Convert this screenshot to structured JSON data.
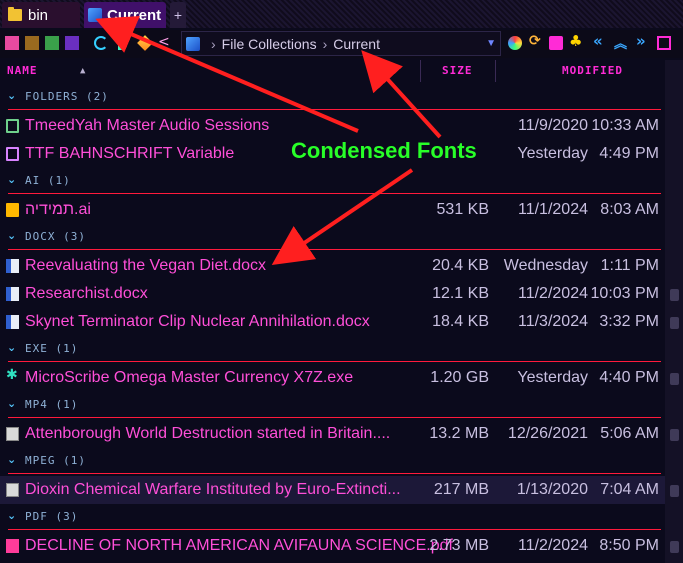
{
  "tabs": [
    {
      "label": "bin"
    },
    {
      "label": "Current"
    },
    {
      "label": "+"
    }
  ],
  "breadcrumb": {
    "root": "File Collections",
    "separator": "›",
    "current": "Current"
  },
  "columns": {
    "name": "NAME",
    "size": "SIZE",
    "modified": "MODIFIED"
  },
  "groups": [
    {
      "label": "FOLDERS (2)",
      "files": [
        {
          "name": "TmeedYah Master Audio Sessions",
          "size": "",
          "date": "11/9/2020",
          "time": "10:33 AM",
          "icon": "folder-icon"
        },
        {
          "name": "TTF BAHNSCHRIFT Variable",
          "size": "",
          "date": "Yesterday",
          "time": "4:49 PM",
          "icon": "folder-icon"
        }
      ]
    },
    {
      "label": "AI (1)",
      "files": [
        {
          "name": "תמידיה.ai",
          "size": "531 KB",
          "date": "11/1/2024",
          "time": "8:03 AM",
          "icon": "ai-file-icon"
        }
      ]
    },
    {
      "label": "DOCX (3)",
      "files": [
        {
          "name": "Reevaluating the Vegan Diet.docx",
          "size": "20.4 KB",
          "date": "Wednesday",
          "time": "1:11 PM",
          "icon": "word-doc-icon"
        },
        {
          "name": "Researchist.docx",
          "size": "12.1 KB",
          "date": "11/2/2024",
          "time": "10:03 PM",
          "icon": "word-doc-icon"
        },
        {
          "name": "Skynet Terminator Clip Nuclear Annihilation.docx",
          "size": "18.4 KB",
          "date": "11/3/2024",
          "time": "3:32 PM",
          "icon": "word-doc-icon"
        }
      ]
    },
    {
      "label": "EXE (1)",
      "files": [
        {
          "name": "MicroScribe Omega Master Currency X7Z.exe",
          "size": "1.20 GB",
          "date": "Yesterday",
          "time": "4:40 PM",
          "icon": "exe-icon"
        }
      ]
    },
    {
      "label": "MP4 (1)",
      "files": [
        {
          "name": "Attenborough World Destruction started in Britain....",
          "size": "13.2 MB",
          "date": "12/26/2021",
          "time": "5:06 AM",
          "icon": "video-file-icon"
        }
      ]
    },
    {
      "label": "MPEG (1)",
      "files": [
        {
          "name": "Dioxin Chemical Warfare Instituted by Euro-Extincti...",
          "size": "217 MB",
          "date": "1/13/2020",
          "time": "7:04 AM",
          "icon": "video-file-icon"
        }
      ]
    },
    {
      "label": "PDF (3)",
      "files": [
        {
          "name": "DECLINE OF NORTH AMERICAN AVIFAUNA SCIENCE.pdf",
          "size": "2.73 MB",
          "date": "11/2/2024",
          "time": "8:50 PM",
          "icon": "pdf-icon"
        }
      ]
    }
  ],
  "annotation": {
    "label": "Condensed Fonts",
    "color": "#28ff28",
    "arrow_color": "#ff1f1f"
  },
  "colors": {
    "filename": "#ff4fd8",
    "header": "#ff2bd6",
    "group_divider": "#ff1a3c",
    "background": "#0b0a1c"
  }
}
